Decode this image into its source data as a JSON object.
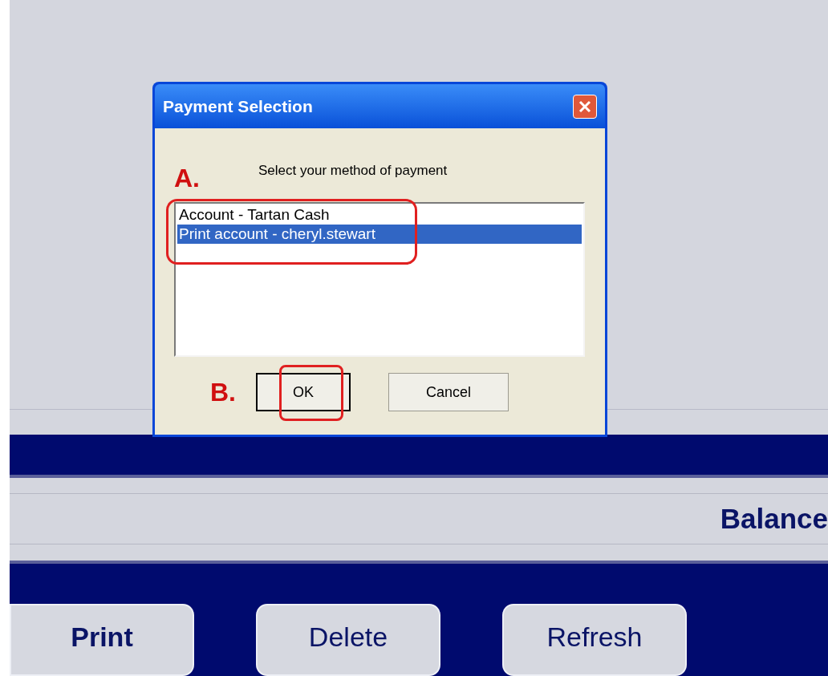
{
  "dialog": {
    "title": "Payment Selection",
    "prompt": "Select your method of payment",
    "options": [
      {
        "label": "Account - Tartan Cash",
        "selected": false
      },
      {
        "label": "Print account - cheryl.stewart",
        "selected": true
      }
    ],
    "buttons": [
      {
        "label": "OK",
        "default": true
      },
      {
        "label": "Cancel",
        "default": false
      }
    ]
  },
  "annotations": [
    {
      "label": "A."
    },
    {
      "label": "B."
    }
  ],
  "balance_bar": {
    "label": "Balance"
  },
  "actions": [
    {
      "label": "Print",
      "bold": true
    },
    {
      "label": "Delete",
      "bold": false
    },
    {
      "label": "Refresh",
      "bold": false
    }
  ]
}
